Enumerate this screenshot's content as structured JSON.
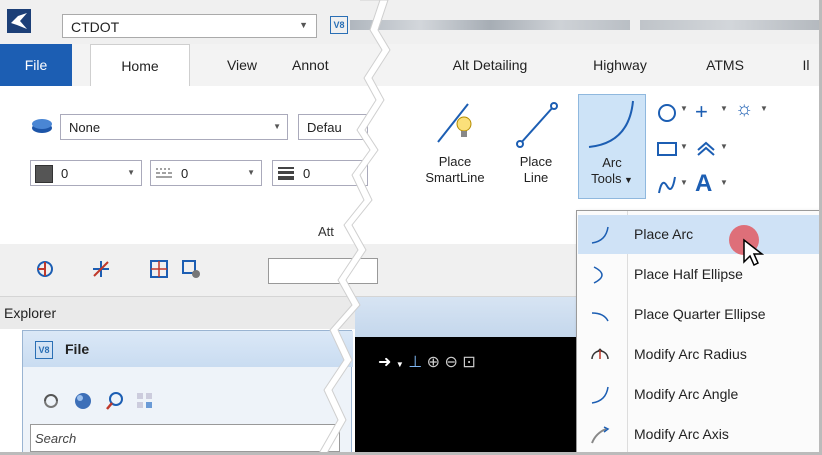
{
  "titlebar": {
    "workspace": "CTDOT",
    "v8_badge": "V8"
  },
  "tabs": [
    "File",
    "Home",
    "View",
    "Annot",
    "Alt Detailing",
    "Highway",
    "ATMS",
    "Il"
  ],
  "ribbon": {
    "level_value": "None",
    "style_value": "Defau",
    "color_value": "0",
    "linestyle_value": "0",
    "weight_value": "0",
    "group_label": "Att",
    "place_smartline": "Place\nSmartLine",
    "place_line": "Place\nLine",
    "arc_tools": "Arc",
    "arc_tools_2": "Tools"
  },
  "explorer": {
    "title": "Explorer",
    "file_label": "File",
    "search_placeholder": "Search"
  },
  "menu": {
    "items": [
      {
        "label": "Place Arc",
        "icon": "arc-icon"
      },
      {
        "label": "Place Half Ellipse",
        "icon": "half-ellipse-icon"
      },
      {
        "label": "Place Quarter Ellipse",
        "icon": "quarter-ellipse-icon"
      },
      {
        "label": "Modify Arc Radius",
        "icon": "arc-radius-icon"
      },
      {
        "label": "Modify Arc Angle",
        "icon": "arc-angle-icon"
      },
      {
        "label": "Modify Arc Axis",
        "icon": "arc-axis-icon"
      }
    ]
  },
  "colors": {
    "accent": "#1c5eb3",
    "highlight": "#cfe2f6",
    "cursor_dot": "#e05a63"
  }
}
